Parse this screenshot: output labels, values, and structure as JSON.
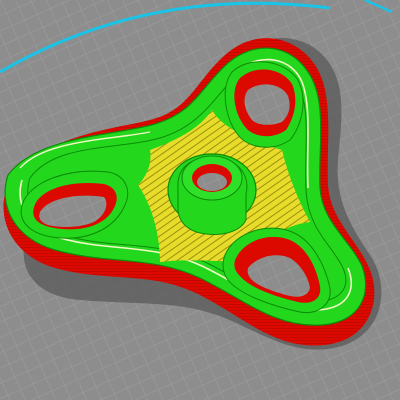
{
  "viewport": {
    "view": "3d-print-layer-preview",
    "object": "three-arm-fidget-spinner-toolpath",
    "feature_colors": {
      "outer_perimeter": "#e00a00",
      "inner_perimeter": "#23d81c",
      "solid_infill": "#e8dc2a",
      "gap_fill": "#f2f6c4",
      "bed_boundary": "#18c4e8",
      "build_plate": "#8d8d8d",
      "build_plate_grid": "#9e9e9e",
      "shadow": "#5c5c5c"
    }
  }
}
